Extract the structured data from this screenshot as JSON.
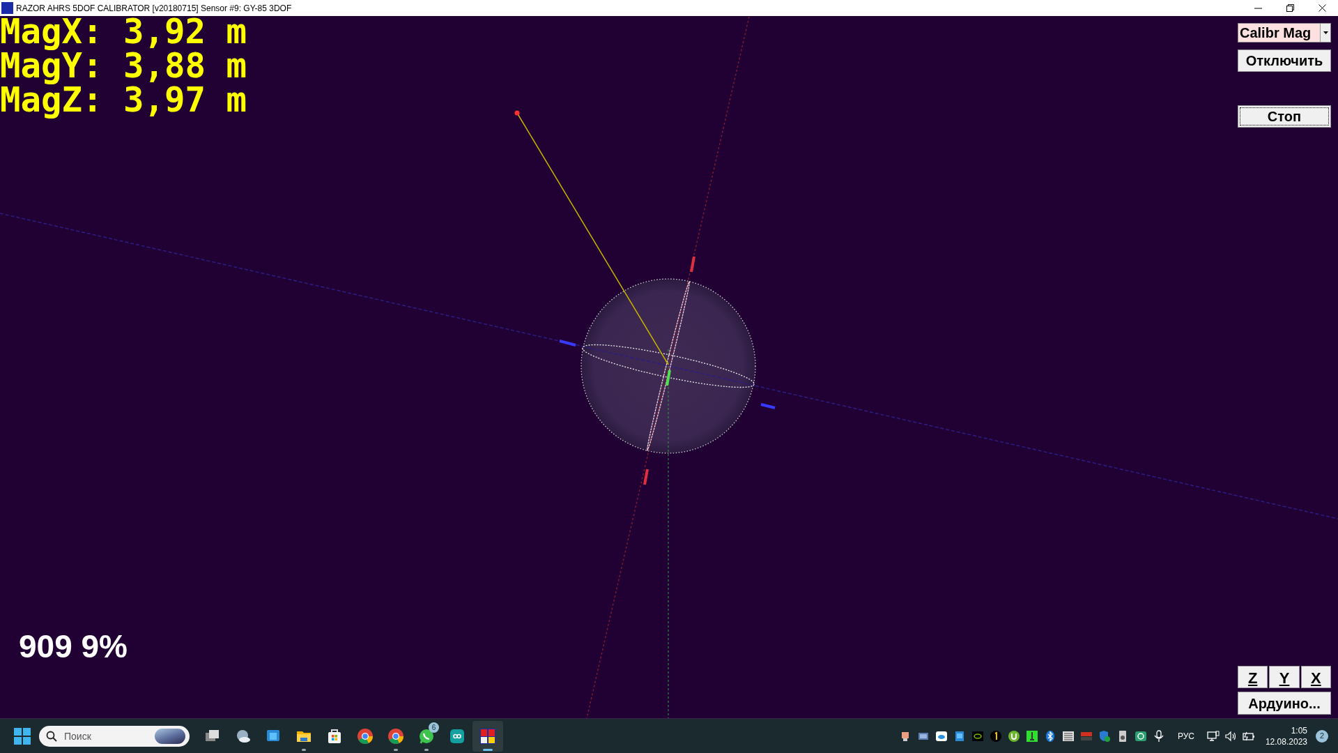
{
  "window": {
    "title": "RAZOR AHRS 5DOF CALIBRATOR [v20180715] Sensor #9: GY-85 3DOF"
  },
  "readouts": [
    "MagX: 3,92 m",
    "MagY: 3,88 m",
    "MagZ: 3,97 m"
  ],
  "progress_text": "909 9%",
  "mode_dropdown": {
    "value": "Calibr Mag"
  },
  "disconnect_button": {
    "label": "Отключить",
    "focused": false
  },
  "stop_button": {
    "label": "Стоп",
    "focused": true
  },
  "axis_buttons": [
    "Z",
    "Y",
    "X"
  ],
  "arduino_button": {
    "label": "Ардуино..."
  },
  "taskbar": {
    "search": {
      "placeholder": "Поиск"
    },
    "apps": [
      {
        "kind": "taskview",
        "running": false,
        "active": false
      },
      {
        "kind": "weather",
        "running": false,
        "active": false
      },
      {
        "kind": "blueapp",
        "running": false,
        "active": false
      },
      {
        "kind": "folder",
        "running": true,
        "active": false
      },
      {
        "kind": "store",
        "running": false,
        "active": false
      },
      {
        "kind": "chrome",
        "running": false,
        "active": false
      },
      {
        "kind": "chrome",
        "running": true,
        "active": false
      },
      {
        "kind": "chat",
        "running": true,
        "active": false,
        "badge": "6"
      },
      {
        "kind": "infinity",
        "running": false,
        "active": false
      },
      {
        "kind": "ahrs",
        "running": true,
        "active": true
      }
    ],
    "tray_icons": [
      {
        "kind": "app"
      },
      {
        "kind": "photos"
      },
      {
        "kind": "cloud"
      },
      {
        "kind": "blue"
      },
      {
        "kind": "nvidia"
      },
      {
        "kind": "one"
      },
      {
        "kind": "torrent"
      },
      {
        "kind": "green"
      },
      {
        "kind": "bluetooth"
      },
      {
        "kind": "grid"
      },
      {
        "kind": "meter"
      },
      {
        "kind": "shield"
      },
      {
        "kind": "speakerbox"
      },
      {
        "kind": "vpn"
      },
      {
        "kind": "mic"
      }
    ],
    "language": "РУС",
    "time": "1:05",
    "date": "12.08.2023",
    "notifications": "2"
  }
}
